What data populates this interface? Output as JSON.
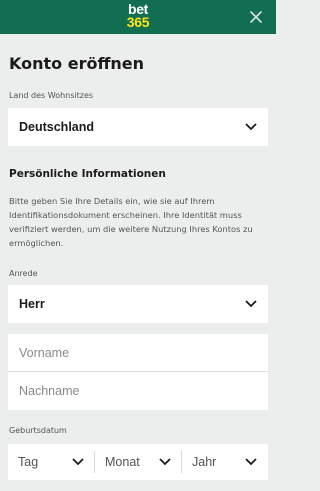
{
  "header": {
    "logo_line1": "bet",
    "logo_line2": "365",
    "brand_color": "#126e51",
    "logo_accent": "#ffe418",
    "close_icon": "close-icon"
  },
  "form": {
    "title": "Konto eröffnen",
    "country": {
      "label": "Land des Wohnsitzes",
      "value": "Deutschland"
    },
    "personal": {
      "title": "Persönliche Informationen",
      "description": "Bitte geben Sie Ihre Details ein, wie sie auf Ihrem Identifikationsdokument erscheinen. Ihre Identität muss verifiziert werden, um die weitere Nutzung Ihres Kontos zu ermöglichen."
    },
    "salutation": {
      "label": "Anrede",
      "value": "Herr"
    },
    "first_name": {
      "placeholder": "Vorname",
      "value": ""
    },
    "last_name": {
      "placeholder": "Nachname",
      "value": ""
    },
    "dob": {
      "label": "Geburtsdatum",
      "day": "Tag",
      "month": "Monat",
      "year": "Jahr"
    }
  }
}
